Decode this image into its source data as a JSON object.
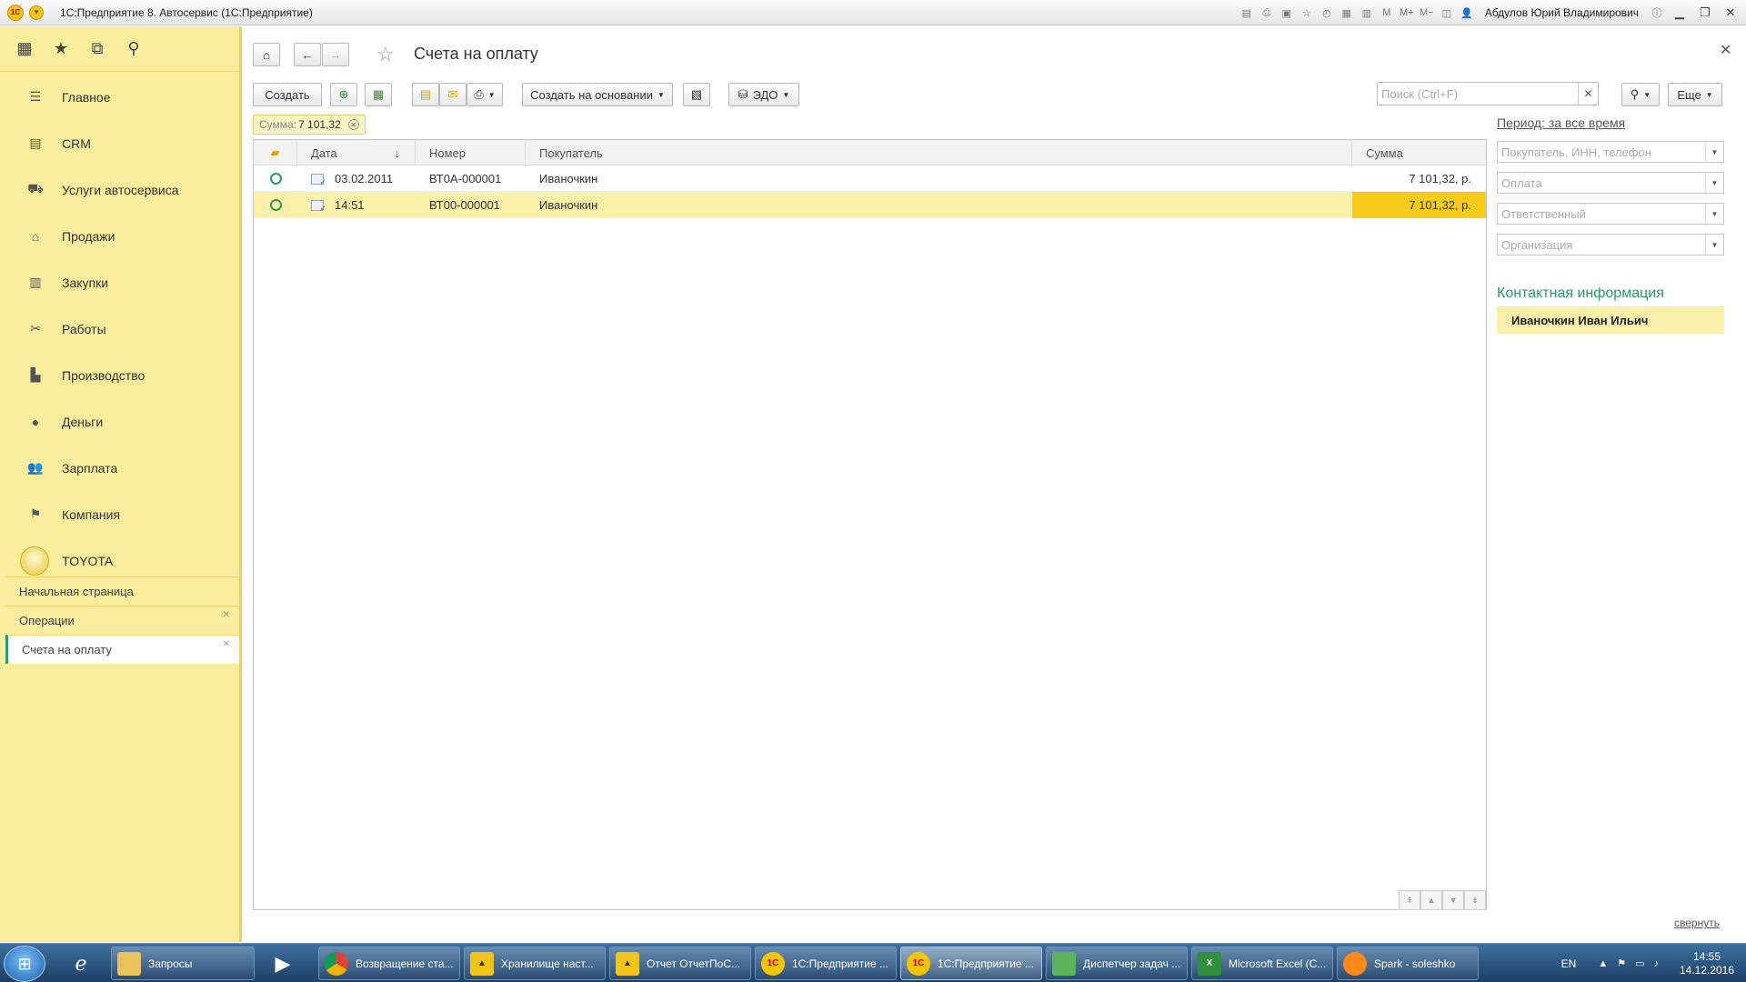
{
  "window": {
    "title": "1С:Предприятие 8. Автосервис  (1С:Предприятие)",
    "user": "Абдулов Юрий Владимирович"
  },
  "nav": {
    "sections": [
      {
        "label": "Главное",
        "icon": "list-icon"
      },
      {
        "label": "CRM",
        "icon": "crm-icon"
      },
      {
        "label": "Услуги автосервиса",
        "icon": "car-icon"
      },
      {
        "label": "Продажи",
        "icon": "basket-icon"
      },
      {
        "label": "Закупки",
        "icon": "cart-icon"
      },
      {
        "label": "Работы",
        "icon": "tools-icon"
      },
      {
        "label": "Производство",
        "icon": "factory-icon"
      },
      {
        "label": "Деньги",
        "icon": "ruble-icon"
      },
      {
        "label": "Зарплата",
        "icon": "people-icon"
      },
      {
        "label": "Компания",
        "icon": "flag-icon"
      },
      {
        "label": "TOYOTA",
        "icon": "toyota-logo-icon"
      }
    ],
    "open_windows": [
      {
        "label": "Начальная страница",
        "closable": false
      },
      {
        "label": "Операции",
        "closable": true
      },
      {
        "label": "Счета на оплату",
        "closable": true
      }
    ]
  },
  "form": {
    "title": "Счета на оплату",
    "toolbar": {
      "create": "Создать",
      "create_basis": "Создать на основании",
      "edo": "ЭДО",
      "more": "Еще"
    },
    "search_placeholder": "Поиск (Ctrl+F)",
    "filter": {
      "label": "Сумма:",
      "value": "7 101,32"
    }
  },
  "table": {
    "columns": [
      "Дата",
      "Номер",
      "Покупатель",
      "Сумма"
    ],
    "rows": [
      {
        "date": "03.02.2011",
        "number": "ВТ0А-000001",
        "buyer": "Иваночкин",
        "sum": "7 101,32, р.",
        "selected": false
      },
      {
        "date": "14:51",
        "number": "ВТ00-000001",
        "buyer": "Иваночкин",
        "sum": "7 101,32, р.",
        "selected": true
      }
    ]
  },
  "right_panel": {
    "period": "Период: за все время",
    "fields": [
      "Покупатель, ИНН, телефон",
      "Оплата",
      "Ответственный",
      "Организация"
    ],
    "contact_title": "Контактная информация",
    "contact_name": "Иваночкин Иван Ильич",
    "collapse": "свернуть"
  },
  "taskbar": {
    "tasks": [
      {
        "label": "Запросы",
        "icon": "folder-icon",
        "color": "#e8c25a"
      },
      {
        "label": "Возвращение ста...",
        "icon": "chrome-icon",
        "color": "#ffffff"
      },
      {
        "label": "Хранилище наст...",
        "icon": "compass-icon",
        "color": "#f0c419"
      },
      {
        "label": "Отчет ОтчетПоС...",
        "icon": "compass-icon",
        "color": "#f0c419"
      },
      {
        "label": "1С:Предприятие ...",
        "icon": "1c-icon",
        "color": "#f5c400"
      },
      {
        "label": "1С:Предприятие ...",
        "icon": "1c-icon",
        "color": "#f5c400"
      },
      {
        "label": "Диспетчер задач ...",
        "icon": "task-manager-icon",
        "color": "#5bb35b"
      },
      {
        "label": "Microsoft Excel (С...",
        "icon": "excel-icon",
        "color": "#2f8f3f"
      },
      {
        "label": "Spark - soleshko",
        "icon": "spark-icon",
        "color": "#ff8a1a"
      }
    ],
    "lang": "EN",
    "time": "14:55",
    "date": "14.12.2016"
  }
}
